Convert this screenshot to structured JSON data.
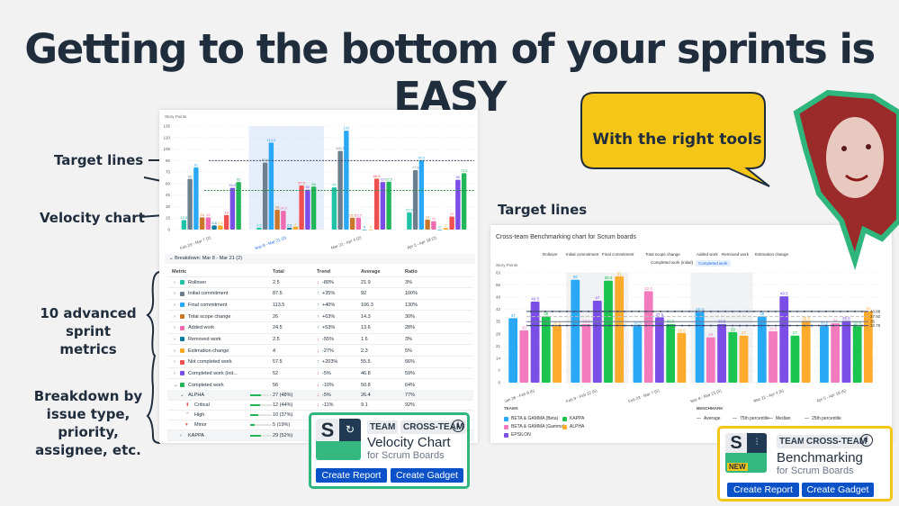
{
  "headline": "Getting to the bottom of your sprints is EASY",
  "annotations": {
    "target_lines_left": "Target lines",
    "velocity_chart": "Velocity chart",
    "metrics": "10 advanced sprint metrics",
    "breakdown": "Breakdown by issue type, priority, assignee, etc.",
    "target_lines_right": "Target lines"
  },
  "bubble": "With the right tools",
  "velocity": {
    "breakdown_label": "Breakdown: Mar 8 - Mar 21 (2)",
    "columns": [
      "Metric",
      "Total",
      "Trend",
      "Average",
      "Ratio"
    ],
    "rows": [
      {
        "name": "Rollover",
        "color": "#1fc3a8",
        "total": "2.5",
        "dir": "down",
        "trend": "-80%",
        "avg": "21.9",
        "ratio": "3%"
      },
      {
        "name": "Initial commitment",
        "color": "#6c7f8e",
        "total": "87.5",
        "dir": "up",
        "trend": "+35%",
        "avg": "92",
        "ratio": "100%"
      },
      {
        "name": "Final commitment",
        "color": "#28a8f5",
        "total": "113.5",
        "dir": "up",
        "trend": "+40%",
        "avg": "106.3",
        "ratio": "130%"
      },
      {
        "name": "Total scope change",
        "color": "#c9772a",
        "total": "26",
        "dir": "up",
        "trend": "+63%",
        "avg": "14.3",
        "ratio": "30%"
      },
      {
        "name": "Added work",
        "color": "#f06bb0",
        "total": "24.5",
        "dir": "up",
        "trend": "+53%",
        "avg": "13.6",
        "ratio": "28%"
      },
      {
        "name": "Removed work",
        "color": "#0b7aa0",
        "total": "2.5",
        "dir": "down",
        "trend": "-55%",
        "avg": "1.6",
        "ratio": "3%"
      },
      {
        "name": "Estimation change",
        "color": "#f9a825",
        "total": "4",
        "dir": "down",
        "trend": "-27%",
        "avg": "2.3",
        "ratio": "5%"
      },
      {
        "name": "Not completed work",
        "color": "#f05050",
        "total": "57.5",
        "dir": "up",
        "trend": "+203%",
        "avg": "55.5",
        "ratio": "66%"
      },
      {
        "name": "Completed work (init...",
        "color": "#7b4ee8",
        "total": "52",
        "dir": "down",
        "trend": "-5%",
        "avg": "46.8",
        "ratio": "59%"
      },
      {
        "name": "Completed work",
        "color": "#22b55a",
        "total": "56",
        "dir": "down",
        "trend": "-10%",
        "avg": "50.8",
        "ratio": "64%"
      }
    ],
    "subrows": [
      {
        "name": "ALPHA",
        "fill": 48,
        "total": "27 (48%)",
        "trend": "-5%",
        "avg": "26.4",
        "ratio": "77%",
        "icon": ""
      },
      {
        "name": "Critical",
        "fill": 44,
        "total": "12 (44%)",
        "trend": "-11%",
        "avg": "9.1",
        "ratio": "92%",
        "icon": "critical-priority-icon"
      },
      {
        "name": "High",
        "fill": 37,
        "total": "10 (37%)",
        "trend": "",
        "avg": "",
        "ratio": "",
        "icon": "high-priority-icon"
      },
      {
        "name": "Minor",
        "fill": 19,
        "total": "5 (19%)",
        "trend": "",
        "avg": "",
        "ratio": "",
        "icon": "minor-priority-icon"
      },
      {
        "name": "KAPPA",
        "fill": 52,
        "total": "29 (52%)",
        "trend": "",
        "avg": "",
        "ratio": "",
        "icon": ""
      }
    ]
  },
  "velocity_card": {
    "tags": [
      "TEAM",
      "CROSS-TEAM"
    ],
    "title": "Velocity Chart",
    "subtitle": "for Scrum Boards",
    "create_report": "Create Report",
    "create_gadget": "Create Gadget",
    "border": "#2fb67c"
  },
  "bench_card": {
    "tags": [
      "TEAM",
      "CROSS-TEAM"
    ],
    "title": "Benchmarking",
    "subtitle": "for Scrum Boards",
    "badge": "NEW",
    "create_report": "Create Report",
    "create_gadget": "Create Gadget",
    "border": "#f5c518"
  },
  "bench": {
    "title": "Cross-team Benchmarking chart for Scrum boards",
    "filters": [
      "Rollover",
      "Initial commitment",
      "Final commitment",
      "Total scope change",
      "Added work",
      "Removed work",
      "Estimation change",
      "Completed work (initial)",
      "Completed work"
    ],
    "active_filter": "Completed work",
    "teams_title": "TEAMS",
    "benchmark_title": "BENCHMARK",
    "benchmark_legend": [
      "Average",
      "75th percentile",
      "Median",
      "25th percentile"
    ]
  },
  "chart_data": [
    {
      "type": "bar",
      "ylabel": "Story Points",
      "ylim": [
        0,
        135
      ],
      "yticks": [
        0,
        15,
        30,
        45,
        60,
        75,
        90,
        105,
        120,
        135
      ],
      "categories": [
        "Feb 23 - Mar 7 (2)",
        "Mar 8 - Mar 21 (2)",
        "Mar 22 - Apr 4 (2)",
        "Apr 5 - Apr 18 (2)"
      ],
      "highlighted": "Mar 8 - Mar 21 (2)",
      "target_lines": [
        90,
        51
      ],
      "series": [
        {
          "name": "Rollover",
          "color": "#1fc3a8",
          "values": [
            12.5,
            2.5,
            55,
            22.5
          ]
        },
        {
          "name": "Initial commitment",
          "color": "#6c7f8e",
          "values": [
            66,
            87.5,
            102.5,
            77.5
          ]
        },
        {
          "name": "Final commitment",
          "color": "#28a8f5",
          "values": [
            81,
            113.5,
            129,
            90.5
          ]
        },
        {
          "name": "Total scope change",
          "color": "#c9772a",
          "values": [
            16,
            26,
            15.5,
            13
          ]
        },
        {
          "name": "Added work",
          "color": "#f06bb0",
          "values": [
            16,
            24.5,
            15.5,
            11
          ]
        },
        {
          "name": "Removed work",
          "color": "#0b7aa0",
          "values": [
            5.5,
            2.5,
            0,
            0
          ]
        },
        {
          "name": "Estimation change",
          "color": "#f9a825",
          "values": [
            5.5,
            4,
            0,
            2
          ]
        },
        {
          "name": "Not completed work",
          "color": "#f05050",
          "values": [
            19,
            57.5,
            66.5,
            17
          ]
        },
        {
          "name": "Completed work (initial)",
          "color": "#7b4ee8",
          "values": [
            54.5,
            52,
            62,
            65
          ]
        },
        {
          "name": "Completed work",
          "color": "#22b55a",
          "values": [
            62,
            56,
            62.5,
            73.5
          ]
        }
      ]
    },
    {
      "type": "bar",
      "ylabel": "Story Points",
      "ylim": [
        0,
        63
      ],
      "yticks": [
        0,
        7,
        14,
        21,
        28,
        35,
        42,
        49,
        56,
        63
      ],
      "categories": [
        "Jan 26 - Feb 8 (5)",
        "Feb 9 - Feb 22 (5)",
        "Feb 23 - Mar 7 (5)",
        "Mar 8 - Mar 21 (5)",
        "Mar 22 - Apr 4 (5)",
        "Apr 5 - Apr 18 (5)"
      ],
      "series": [
        {
          "name": "BETA & GAMMA (Beta)",
          "color": "#28a8f5",
          "values": [
            37,
            59,
            32.5,
            40.5,
            38,
            32.5
          ]
        },
        {
          "name": "BETA & GAMMA (Gamma)",
          "color": "#f37bbd",
          "values": [
            30,
            33.5,
            52.5,
            26,
            29.5,
            34
          ]
        },
        {
          "name": "EPSILON",
          "color": "#7b4ee8",
          "values": [
            46.5,
            47,
            37.5,
            33.5,
            49.5,
            35.5
          ]
        },
        {
          "name": "KAPPA",
          "color": "#1bc44e",
          "values": [
            38,
            58.5,
            33.5,
            29,
            27,
            32.5
          ]
        },
        {
          "name": "ALPHA",
          "color": "#ffab2e",
          "values": [
            32.5,
            61,
            28.5,
            27,
            35.5,
            41
          ]
        }
      ],
      "benchmarks": [
        {
          "name": "75th percentile",
          "value": 40.88
        },
        {
          "name": "Average",
          "value": 37.92
        },
        {
          "name": "Median",
          "value": 35
        },
        {
          "name": "25th percentile",
          "value": 32.75
        }
      ]
    }
  ]
}
